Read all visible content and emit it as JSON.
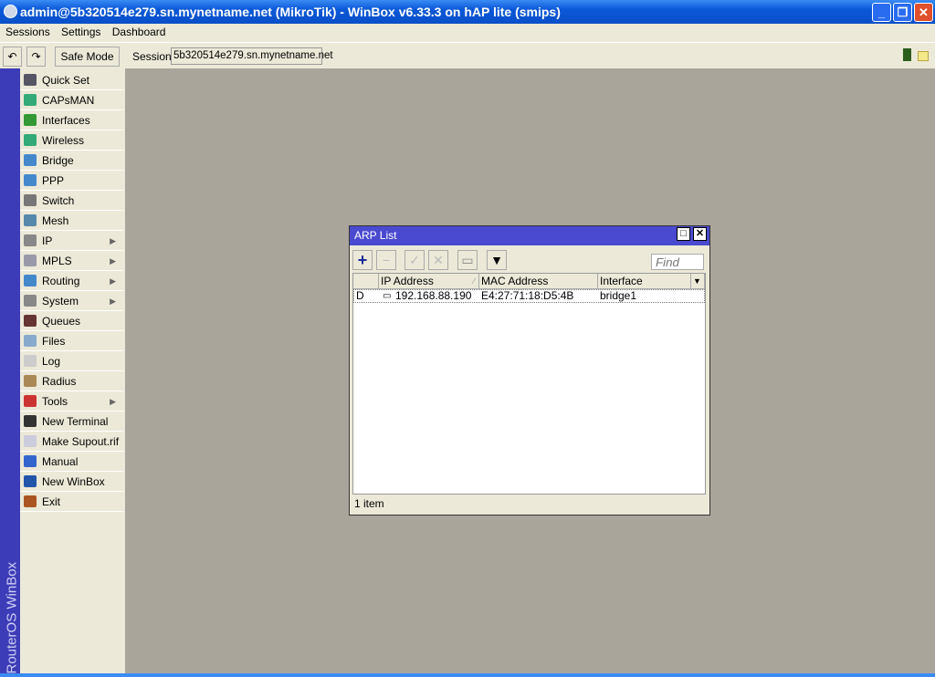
{
  "window": {
    "title": "admin@5b320514e279.sn.mynetname.net (MikroTik) - WinBox v6.33.3 on hAP lite (smips)"
  },
  "menu": [
    "Sessions",
    "Settings",
    "Dashboard"
  ],
  "toolbar": {
    "undo": "↶",
    "redo": "↷",
    "safe_mode": "Safe Mode",
    "session_label": "Session:",
    "session_value": "5b320514e279.sn.mynetname.net"
  },
  "sidebar": {
    "brand": "RouterOS WinBox",
    "items": [
      {
        "label": "Quick Set",
        "sub": false,
        "color": "#556"
      },
      {
        "label": "CAPsMAN",
        "sub": false,
        "color": "#3a7"
      },
      {
        "label": "Interfaces",
        "sub": false,
        "color": "#393"
      },
      {
        "label": "Wireless",
        "sub": false,
        "color": "#3a7"
      },
      {
        "label": "Bridge",
        "sub": false,
        "color": "#48c"
      },
      {
        "label": "PPP",
        "sub": false,
        "color": "#48c"
      },
      {
        "label": "Switch",
        "sub": false,
        "color": "#777"
      },
      {
        "label": "Mesh",
        "sub": false,
        "color": "#58a"
      },
      {
        "label": "IP",
        "sub": true,
        "color": "#888"
      },
      {
        "label": "MPLS",
        "sub": true,
        "color": "#99a"
      },
      {
        "label": "Routing",
        "sub": true,
        "color": "#48c"
      },
      {
        "label": "System",
        "sub": true,
        "color": "#888"
      },
      {
        "label": "Queues",
        "sub": false,
        "color": "#633"
      },
      {
        "label": "Files",
        "sub": false,
        "color": "#8ac"
      },
      {
        "label": "Log",
        "sub": false,
        "color": "#ccc"
      },
      {
        "label": "Radius",
        "sub": false,
        "color": "#a85"
      },
      {
        "label": "Tools",
        "sub": true,
        "color": "#c33"
      },
      {
        "label": "New Terminal",
        "sub": false,
        "color": "#333"
      },
      {
        "label": "Make Supout.rif",
        "sub": false,
        "color": "#ccd"
      },
      {
        "label": "Manual",
        "sub": false,
        "color": "#36c"
      },
      {
        "label": "New WinBox",
        "sub": false,
        "color": "#25a"
      },
      {
        "label": "Exit",
        "sub": false,
        "color": "#a52"
      }
    ]
  },
  "arp": {
    "title": "ARP List",
    "find_placeholder": "Find",
    "columns": [
      "IP Address",
      "MAC Address",
      "Interface"
    ],
    "rows": [
      {
        "flag": "D",
        "ip": "192.168.88.190",
        "mac": "E4:27:71:18:D5:4B",
        "interface": "bridge1"
      }
    ],
    "status": "1 item"
  }
}
